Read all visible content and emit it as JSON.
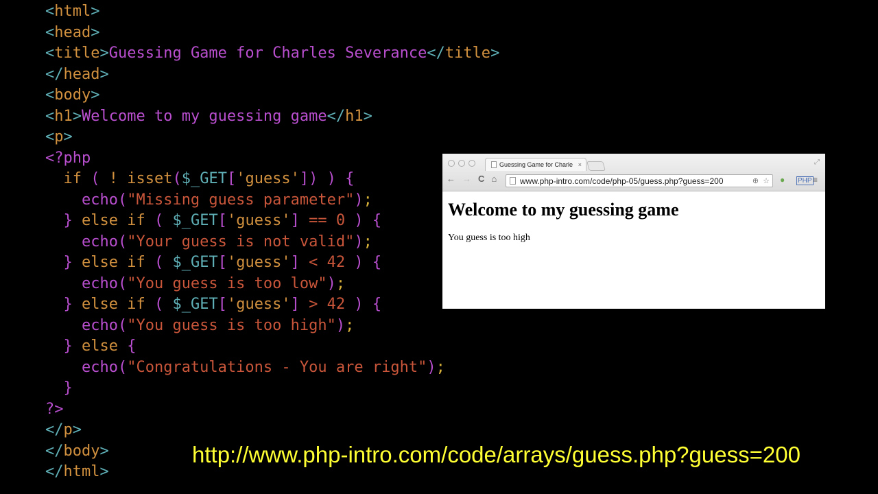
{
  "code": {
    "lines": [
      {
        "indent": "",
        "parts": [
          [
            "br",
            "<"
          ],
          [
            "tg",
            "html"
          ],
          [
            "br",
            ">"
          ]
        ]
      },
      {
        "indent": "",
        "parts": [
          [
            "br",
            "<"
          ],
          [
            "tg",
            "head"
          ],
          [
            "br",
            ">"
          ]
        ]
      },
      {
        "indent": "",
        "parts": [
          [
            "br",
            "<"
          ],
          [
            "tg",
            "title"
          ],
          [
            "br",
            ">"
          ],
          [
            "tx",
            "Guessing Game for Charles Severance"
          ],
          [
            "br",
            "</"
          ],
          [
            "tg",
            "title"
          ],
          [
            "br",
            ">"
          ]
        ]
      },
      {
        "indent": "",
        "parts": [
          [
            "br",
            "</"
          ],
          [
            "tg",
            "head"
          ],
          [
            "br",
            ">"
          ]
        ]
      },
      {
        "indent": "",
        "parts": [
          [
            "br",
            "<"
          ],
          [
            "tg",
            "body"
          ],
          [
            "br",
            ">"
          ]
        ]
      },
      {
        "indent": "",
        "parts": [
          [
            "br",
            "<"
          ],
          [
            "tg",
            "h1"
          ],
          [
            "br",
            ">"
          ],
          [
            "tx",
            "Welcome to my guessing game"
          ],
          [
            "br",
            "</"
          ],
          [
            "tg",
            "h1"
          ],
          [
            "br",
            ">"
          ]
        ]
      },
      {
        "indent": "",
        "parts": [
          [
            "br",
            "<"
          ],
          [
            "tg",
            "p"
          ],
          [
            "br",
            ">"
          ]
        ]
      },
      {
        "indent": "",
        "parts": [
          [
            "pu",
            "<?php"
          ]
        ]
      },
      {
        "indent": "  ",
        "parts": [
          [
            "tg",
            "if "
          ],
          [
            "pu",
            "( "
          ],
          [
            "tg",
            "! isset"
          ],
          [
            "pu",
            "("
          ],
          [
            "br",
            "$_GET"
          ],
          [
            "pu",
            "["
          ],
          [
            "tg",
            "'guess'"
          ],
          [
            "pu",
            "]) ) {"
          ]
        ]
      },
      {
        "indent": "    ",
        "parts": [
          [
            "pu",
            "echo("
          ],
          [
            "st",
            "\"Missing guess parameter\""
          ],
          [
            "pu",
            ")"
          ],
          [
            "ye",
            ";"
          ]
        ]
      },
      {
        "indent": "  ",
        "parts": [
          [
            "pu",
            "} "
          ],
          [
            "tg",
            "else if "
          ],
          [
            "pu",
            "( "
          ],
          [
            "br",
            "$_GET"
          ],
          [
            "pu",
            "["
          ],
          [
            "tg",
            "'guess'"
          ],
          [
            "pu",
            "] "
          ],
          [
            "st",
            "== 0 "
          ],
          [
            "pu",
            ") {"
          ]
        ]
      },
      {
        "indent": "    ",
        "parts": [
          [
            "pu",
            "echo("
          ],
          [
            "st",
            "\"Your guess is not valid\""
          ],
          [
            "pu",
            ")"
          ],
          [
            "ye",
            ";"
          ]
        ]
      },
      {
        "indent": "  ",
        "parts": [
          [
            "pu",
            "} "
          ],
          [
            "tg",
            "else if "
          ],
          [
            "pu",
            "( "
          ],
          [
            "br",
            "$_GET"
          ],
          [
            "pu",
            "["
          ],
          [
            "tg",
            "'guess'"
          ],
          [
            "pu",
            "] "
          ],
          [
            "st",
            "< 42 "
          ],
          [
            "pu",
            ") {"
          ]
        ]
      },
      {
        "indent": "    ",
        "parts": [
          [
            "pu",
            "echo("
          ],
          [
            "st",
            "\"You guess is too low\""
          ],
          [
            "pu",
            ")"
          ],
          [
            "ye",
            ";"
          ]
        ]
      },
      {
        "indent": "  ",
        "parts": [
          [
            "pu",
            "} "
          ],
          [
            "tg",
            "else if "
          ],
          [
            "pu",
            "( "
          ],
          [
            "br",
            "$_GET"
          ],
          [
            "pu",
            "["
          ],
          [
            "tg",
            "'guess'"
          ],
          [
            "pu",
            "] "
          ],
          [
            "st",
            "> 42 "
          ],
          [
            "pu",
            ") {"
          ]
        ]
      },
      {
        "indent": "    ",
        "parts": [
          [
            "pu",
            "echo("
          ],
          [
            "st",
            "\"You guess is too high\""
          ],
          [
            "pu",
            ")"
          ],
          [
            "ye",
            ";"
          ]
        ]
      },
      {
        "indent": "  ",
        "parts": [
          [
            "pu",
            "} "
          ],
          [
            "tg",
            "else "
          ],
          [
            "pu",
            "{"
          ]
        ]
      },
      {
        "indent": "    ",
        "parts": [
          [
            "pu",
            "echo("
          ],
          [
            "st",
            "\"Congratulations - You are right\""
          ],
          [
            "pu",
            ")"
          ],
          [
            "ye",
            ";"
          ]
        ]
      },
      {
        "indent": "  ",
        "parts": [
          [
            "pu",
            "}"
          ]
        ]
      },
      {
        "indent": "",
        "parts": [
          [
            "pu",
            "?>"
          ]
        ]
      },
      {
        "indent": "",
        "parts": [
          [
            "br",
            "</"
          ],
          [
            "tg",
            "p"
          ],
          [
            "br",
            ">"
          ]
        ]
      },
      {
        "indent": "",
        "parts": [
          [
            "br",
            "</"
          ],
          [
            "tg",
            "body"
          ],
          [
            "br",
            ">"
          ]
        ]
      },
      {
        "indent": "",
        "parts": [
          [
            "br",
            "</"
          ],
          [
            "tg",
            "html"
          ],
          [
            "br",
            ">"
          ]
        ]
      }
    ]
  },
  "browser": {
    "tab_title": "Guessing Game for Charle",
    "tab_close": "×",
    "url": "www.php-intro.com/code/php-05/guess.php?guess=200",
    "nav": {
      "back": "←",
      "forward": "→",
      "reload": "C",
      "home": "⌂"
    },
    "omni_icons": {
      "zoom": "⊕",
      "star": "☆"
    },
    "menu": "≡",
    "page": {
      "heading": "Welcome to my guessing game",
      "message": "You guess is too high"
    }
  },
  "caption_url": "http://www.php-intro.com/code/arrays/guess.php?guess=200"
}
